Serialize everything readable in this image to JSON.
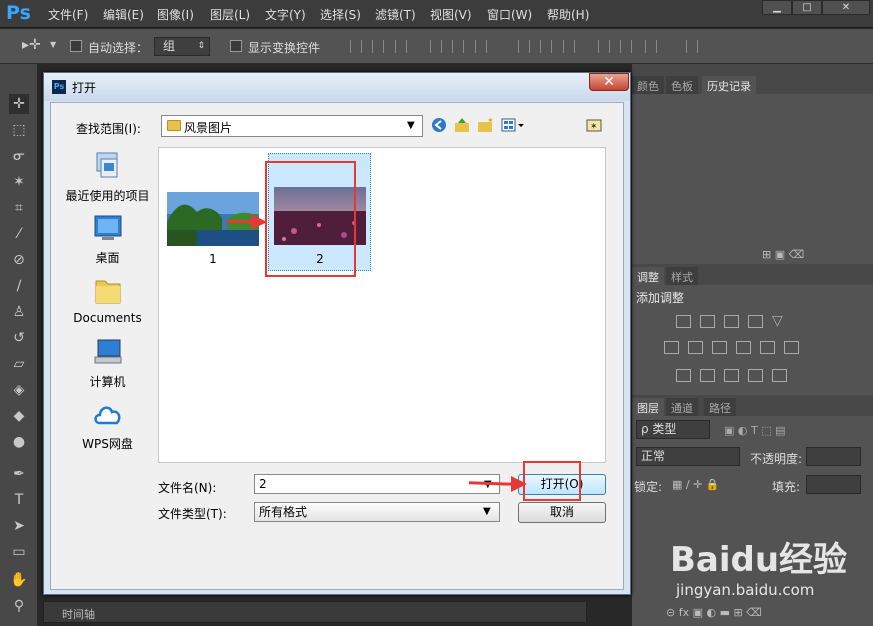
{
  "app": {
    "logo": "Ps",
    "menu": [
      "文件(F)",
      "编辑(E)",
      "图像(I)",
      "图层(L)",
      "文字(Y)",
      "选择(S)",
      "滤镜(T)",
      "视图(V)",
      "窗口(W)",
      "帮助(H)"
    ],
    "window_buttons": [
      "▁",
      "□",
      "✕"
    ]
  },
  "options_bar": {
    "auto_select_label": "自动选择：",
    "auto_select_value": "组",
    "show_transform_label": "显示变换控件"
  },
  "panels": {
    "top_tabs": [
      "颜色",
      "色板",
      "历史记录"
    ],
    "adjust_tabs": [
      "调整",
      "样式"
    ],
    "adjust_title": "添加调整",
    "layers_tabs": [
      "图层",
      "通道",
      "路径"
    ],
    "layer_kind": "ρ 类型",
    "blend_mode": "正常",
    "opacity_label": "不透明度:",
    "lock_label": "锁定:",
    "fill_label": "填充:"
  },
  "dialog": {
    "title": "打开",
    "look_in_label": "查找范围(I):",
    "look_in_value": "风景图片",
    "places": [
      "最近使用的项目",
      "桌面",
      "Documents",
      "计算机",
      "WPS网盘"
    ],
    "files": [
      {
        "name": "1"
      },
      {
        "name": "2"
      }
    ],
    "file_name_label": "文件名(N):",
    "file_name_value": "2",
    "file_type_label": "文件类型(T):",
    "file_type_value": "所有格式",
    "open_button": "打开(O)",
    "cancel_button": "取消"
  },
  "timeline": {
    "label": "时间轴"
  },
  "watermark": {
    "brand": "Baidu经验",
    "url": "jingyan.baidu.com"
  },
  "colors": {
    "accent_red": "#e53935",
    "ps_blue": "#35a7ff"
  }
}
